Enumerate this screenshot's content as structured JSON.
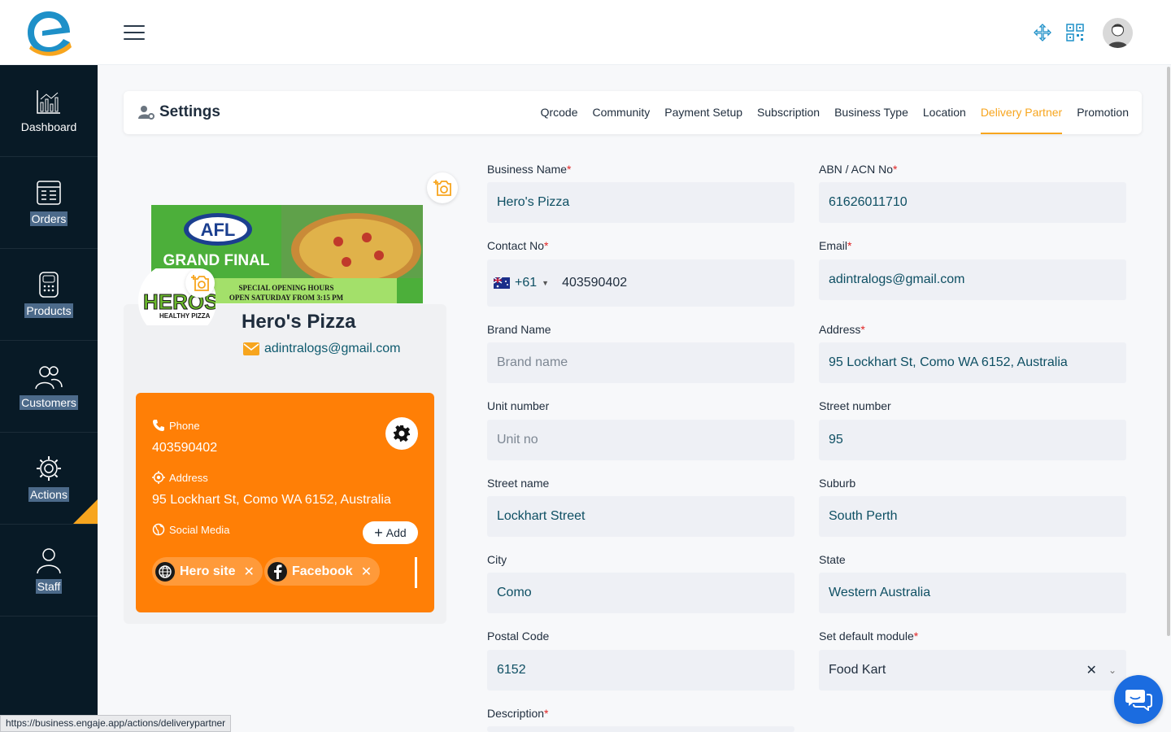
{
  "sidebar": {
    "items": [
      {
        "label": "Dashboard",
        "icon": "chart-icon"
      },
      {
        "label": "Orders",
        "icon": "orders-icon"
      },
      {
        "label": "Products",
        "icon": "products-icon"
      },
      {
        "label": "Customers",
        "icon": "customers-icon"
      },
      {
        "label": "Actions",
        "icon": "gear-icon"
      },
      {
        "label": "Staff",
        "icon": "staff-icon"
      }
    ]
  },
  "settings": {
    "title": "Settings",
    "tabs": [
      "Qrcode",
      "Community",
      "Payment Setup",
      "Subscription",
      "Business Type",
      "Location",
      "Delivery Partner",
      "Promotion"
    ],
    "active_tab": "Delivery Partner"
  },
  "profile": {
    "business_name": "Hero's Pizza",
    "email": "adintralogs@gmail.com",
    "banner_text_1": "AFL",
    "banner_text_2": "GRAND FINAL",
    "banner_text_3": "SPECIAL OPENING HOURS",
    "banner_text_4": "OPEN SATURDAY FROM 3:15 PM",
    "logo_text_1": "HEROS",
    "logo_text_2": "HEALTHY PIZZA",
    "phone_label": "Phone",
    "phone": "403590402",
    "address_label": "Address",
    "address": "95 Lockhart St, Como WA 6152, Australia",
    "social_label": "Social Media",
    "add_label": "Add",
    "social_links": [
      {
        "label": "Hero site",
        "icon": "globe-icon"
      },
      {
        "label": "Facebook",
        "icon": "facebook-icon"
      }
    ]
  },
  "form": {
    "business_name_label": "Business Name",
    "business_name": "Hero's Pizza",
    "abn_label": "ABN / ACN No",
    "abn": "61626011710",
    "contact_label": "Contact No",
    "country_code": "+61",
    "contact": "403590402",
    "email_label": "Email",
    "email": "adintralogs@gmail.com",
    "brand_label": "Brand Name",
    "brand_placeholder": "Brand name",
    "address_label": "Address",
    "address": "95 Lockhart St, Como WA 6152, Australia",
    "unit_label": "Unit number",
    "unit_placeholder": "Unit no",
    "street_number_label": "Street number",
    "street_number": "95",
    "street_name_label": "Street name",
    "street_name": "Lockhart Street",
    "suburb_label": "Suburb",
    "suburb": "South Perth",
    "city_label": "City",
    "city": "Como",
    "state_label": "State",
    "state": "Western Australia",
    "postal_label": "Postal Code",
    "postal": "6152",
    "module_label": "Set default module",
    "module": "Food Kart",
    "description_label": "Description"
  },
  "status_url": "https://business.engaje.app/actions/deliverypartner",
  "colors": {
    "accent": "#f7a51e",
    "sidebar": "#081a26",
    "card": "#ff7f06",
    "chat": "#1b6ce0"
  }
}
